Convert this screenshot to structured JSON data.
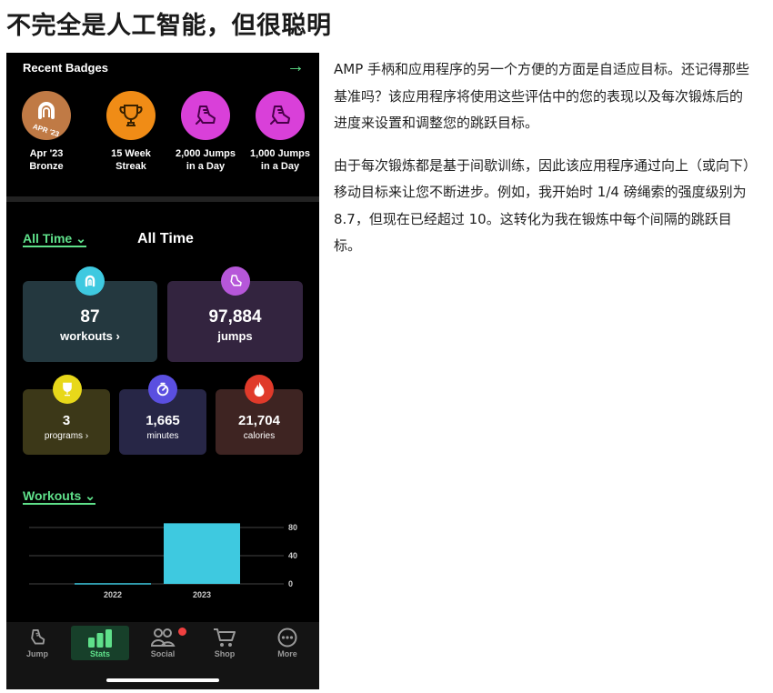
{
  "heading": "不完全是人工智能，但很聪明",
  "article": {
    "p1": "AMP 手柄和应用程序的另一个方便的方面是自适应目标。还记得那些基准吗？该应用程序将使用这些评估中的您的表现以及每次锻炼后的进度来设置和调整您的跳跃目标。",
    "p2": "由于每次锻炼都是基于间歇训练，因此该应用程序通过向上（或向下）移动目标来让您不断进步。例如，我开始时 1/4 磅绳索的强度级别为 8.7，但现在已经超过 10。这转化为我在锻炼中每个间隔的跳跃目标。"
  },
  "app": {
    "badges": {
      "title": "Recent Badges",
      "arrow": "→",
      "items": [
        {
          "line1": "Apr '23",
          "line2": "Bronze",
          "medal_text": "APR '23",
          "icon": "rope-handle-icon",
          "color": "#c07a45"
        },
        {
          "line1": "15 Week",
          "line2": "Streak",
          "icon": "trophy-icon",
          "color": "#f08c16"
        },
        {
          "line1": "2,000 Jumps",
          "line2": "in a Day",
          "icon": "jump-shoe-icon",
          "color": "#d940d9"
        },
        {
          "line1": "1,000 Jumps",
          "line2": "in a Day",
          "icon": "jump-shoe-icon",
          "color": "#d940d9"
        }
      ]
    },
    "stats": {
      "filter_label": "All Time ⌄",
      "title": "All Time",
      "workouts": {
        "value": "87",
        "label": "workouts ›"
      },
      "jumps": {
        "value": "97,884",
        "label": "jumps"
      },
      "programs": {
        "value": "3",
        "label": "programs ›"
      },
      "minutes": {
        "value": "1,665",
        "label": "minutes"
      },
      "calories": {
        "value": "21,704",
        "label": "calories"
      }
    },
    "workouts_filter_label": "Workouts ⌄",
    "chart_data": {
      "type": "bar",
      "categories": [
        "2022",
        "2023"
      ],
      "values": [
        1,
        86
      ],
      "ylim": [
        0,
        80
      ],
      "yticks": [
        0,
        40,
        80
      ],
      "color": "#3ec9e0",
      "grid": true
    },
    "tabs": [
      {
        "label": "Jump",
        "icon": "jump-shoe-icon"
      },
      {
        "label": "Stats",
        "icon": "bar-chart-icon",
        "active": true
      },
      {
        "label": "Social",
        "icon": "people-icon",
        "notification": true
      },
      {
        "label": "Shop",
        "icon": "cart-icon"
      },
      {
        "label": "More",
        "icon": "more-icon"
      }
    ],
    "colors": {
      "accent": "#5fe08a",
      "background": "#000000"
    }
  }
}
